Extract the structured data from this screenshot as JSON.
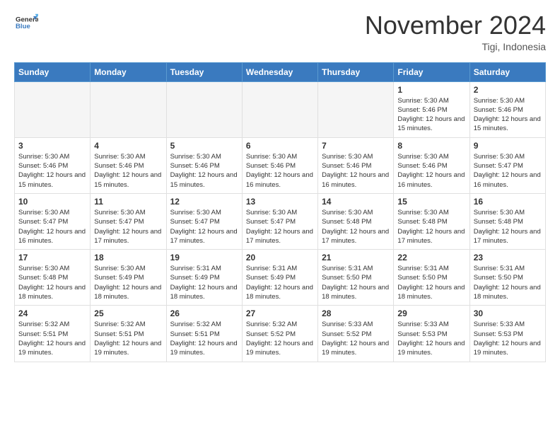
{
  "header": {
    "logo_line1": "General",
    "logo_line2": "Blue",
    "month_title": "November 2024",
    "location": "Tigi, Indonesia"
  },
  "weekdays": [
    "Sunday",
    "Monday",
    "Tuesday",
    "Wednesday",
    "Thursday",
    "Friday",
    "Saturday"
  ],
  "weeks": [
    [
      {
        "day": "",
        "info": ""
      },
      {
        "day": "",
        "info": ""
      },
      {
        "day": "",
        "info": ""
      },
      {
        "day": "",
        "info": ""
      },
      {
        "day": "",
        "info": ""
      },
      {
        "day": "1",
        "info": "Sunrise: 5:30 AM\nSunset: 5:46 PM\nDaylight: 12 hours\nand 15 minutes."
      },
      {
        "day": "2",
        "info": "Sunrise: 5:30 AM\nSunset: 5:46 PM\nDaylight: 12 hours\nand 15 minutes."
      }
    ],
    [
      {
        "day": "3",
        "info": "Sunrise: 5:30 AM\nSunset: 5:46 PM\nDaylight: 12 hours\nand 15 minutes."
      },
      {
        "day": "4",
        "info": "Sunrise: 5:30 AM\nSunset: 5:46 PM\nDaylight: 12 hours\nand 15 minutes."
      },
      {
        "day": "5",
        "info": "Sunrise: 5:30 AM\nSunset: 5:46 PM\nDaylight: 12 hours\nand 15 minutes."
      },
      {
        "day": "6",
        "info": "Sunrise: 5:30 AM\nSunset: 5:46 PM\nDaylight: 12 hours\nand 16 minutes."
      },
      {
        "day": "7",
        "info": "Sunrise: 5:30 AM\nSunset: 5:46 PM\nDaylight: 12 hours\nand 16 minutes."
      },
      {
        "day": "8",
        "info": "Sunrise: 5:30 AM\nSunset: 5:46 PM\nDaylight: 12 hours\nand 16 minutes."
      },
      {
        "day": "9",
        "info": "Sunrise: 5:30 AM\nSunset: 5:47 PM\nDaylight: 12 hours\nand 16 minutes."
      }
    ],
    [
      {
        "day": "10",
        "info": "Sunrise: 5:30 AM\nSunset: 5:47 PM\nDaylight: 12 hours\nand 16 minutes."
      },
      {
        "day": "11",
        "info": "Sunrise: 5:30 AM\nSunset: 5:47 PM\nDaylight: 12 hours\nand 17 minutes."
      },
      {
        "day": "12",
        "info": "Sunrise: 5:30 AM\nSunset: 5:47 PM\nDaylight: 12 hours\nand 17 minutes."
      },
      {
        "day": "13",
        "info": "Sunrise: 5:30 AM\nSunset: 5:47 PM\nDaylight: 12 hours\nand 17 minutes."
      },
      {
        "day": "14",
        "info": "Sunrise: 5:30 AM\nSunset: 5:48 PM\nDaylight: 12 hours\nand 17 minutes."
      },
      {
        "day": "15",
        "info": "Sunrise: 5:30 AM\nSunset: 5:48 PM\nDaylight: 12 hours\nand 17 minutes."
      },
      {
        "day": "16",
        "info": "Sunrise: 5:30 AM\nSunset: 5:48 PM\nDaylight: 12 hours\nand 17 minutes."
      }
    ],
    [
      {
        "day": "17",
        "info": "Sunrise: 5:30 AM\nSunset: 5:48 PM\nDaylight: 12 hours\nand 18 minutes."
      },
      {
        "day": "18",
        "info": "Sunrise: 5:30 AM\nSunset: 5:49 PM\nDaylight: 12 hours\nand 18 minutes."
      },
      {
        "day": "19",
        "info": "Sunrise: 5:31 AM\nSunset: 5:49 PM\nDaylight: 12 hours\nand 18 minutes."
      },
      {
        "day": "20",
        "info": "Sunrise: 5:31 AM\nSunset: 5:49 PM\nDaylight: 12 hours\nand 18 minutes."
      },
      {
        "day": "21",
        "info": "Sunrise: 5:31 AM\nSunset: 5:50 PM\nDaylight: 12 hours\nand 18 minutes."
      },
      {
        "day": "22",
        "info": "Sunrise: 5:31 AM\nSunset: 5:50 PM\nDaylight: 12 hours\nand 18 minutes."
      },
      {
        "day": "23",
        "info": "Sunrise: 5:31 AM\nSunset: 5:50 PM\nDaylight: 12 hours\nand 18 minutes."
      }
    ],
    [
      {
        "day": "24",
        "info": "Sunrise: 5:32 AM\nSunset: 5:51 PM\nDaylight: 12 hours\nand 19 minutes."
      },
      {
        "day": "25",
        "info": "Sunrise: 5:32 AM\nSunset: 5:51 PM\nDaylight: 12 hours\nand 19 minutes."
      },
      {
        "day": "26",
        "info": "Sunrise: 5:32 AM\nSunset: 5:51 PM\nDaylight: 12 hours\nand 19 minutes."
      },
      {
        "day": "27",
        "info": "Sunrise: 5:32 AM\nSunset: 5:52 PM\nDaylight: 12 hours\nand 19 minutes."
      },
      {
        "day": "28",
        "info": "Sunrise: 5:33 AM\nSunset: 5:52 PM\nDaylight: 12 hours\nand 19 minutes."
      },
      {
        "day": "29",
        "info": "Sunrise: 5:33 AM\nSunset: 5:53 PM\nDaylight: 12 hours\nand 19 minutes."
      },
      {
        "day": "30",
        "info": "Sunrise: 5:33 AM\nSunset: 5:53 PM\nDaylight: 12 hours\nand 19 minutes."
      }
    ]
  ],
  "row_styles": [
    "row-white",
    "row-gray",
    "row-white",
    "row-gray",
    "row-white"
  ]
}
